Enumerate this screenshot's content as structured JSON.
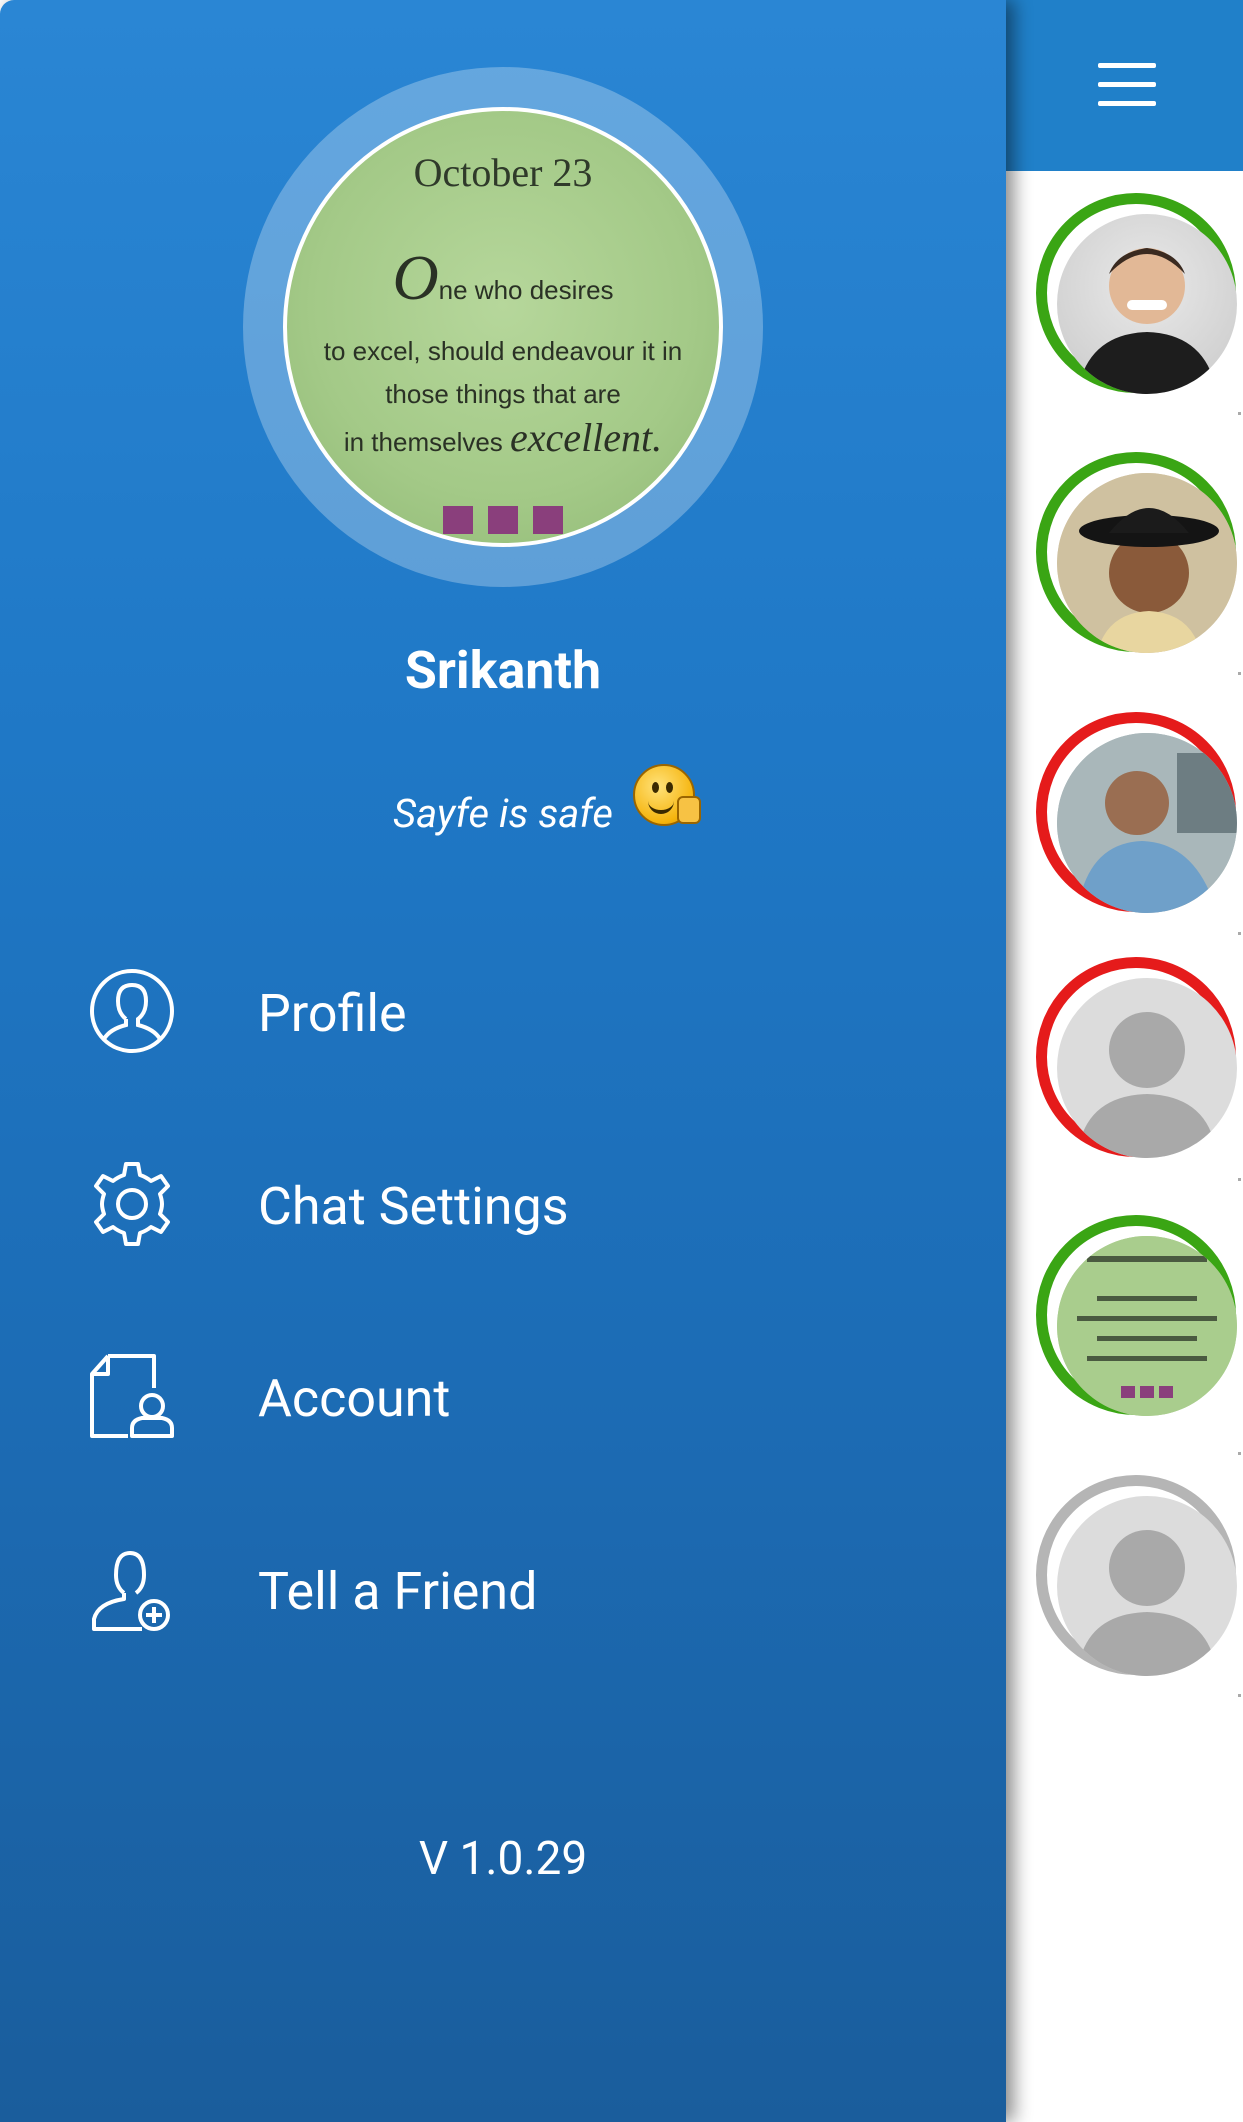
{
  "header": {
    "menu_icon": "hamburger-icon"
  },
  "profile": {
    "avatar_quote": {
      "date": "October 23",
      "line1_initial": "O",
      "line1_rest": "ne who desires",
      "line2": "to excel, should endeavour it in",
      "line3": "those things that are",
      "line4_prefix": "in themselves",
      "line4_emph": "excellent."
    },
    "name": "Srikanth",
    "status": "Sayfe is safe",
    "status_emoji": "thumbs-up-smiley-icon"
  },
  "menu": {
    "items": [
      {
        "label": "Profile",
        "icon": "user-circle-icon"
      },
      {
        "label": "Chat Settings",
        "icon": "gear-icon"
      },
      {
        "label": "Account",
        "icon": "account-document-icon"
      },
      {
        "label": "Tell a Friend",
        "icon": "add-user-icon"
      }
    ]
  },
  "version": "V 1.0.29",
  "contacts": [
    {
      "status": "online",
      "color": "#3aa514"
    },
    {
      "status": "online",
      "color": "#3aa514"
    },
    {
      "status": "busy",
      "color": "#e51b1b"
    },
    {
      "status": "busy",
      "color": "#e51b1b"
    },
    {
      "status": "online",
      "color": "#3aa514"
    },
    {
      "status": "offline",
      "color": "#b5b5b5"
    }
  ],
  "colors": {
    "drawer_top": "#2a86d4",
    "drawer_bottom": "#1a5d9c",
    "header_bar": "#2080c9"
  }
}
